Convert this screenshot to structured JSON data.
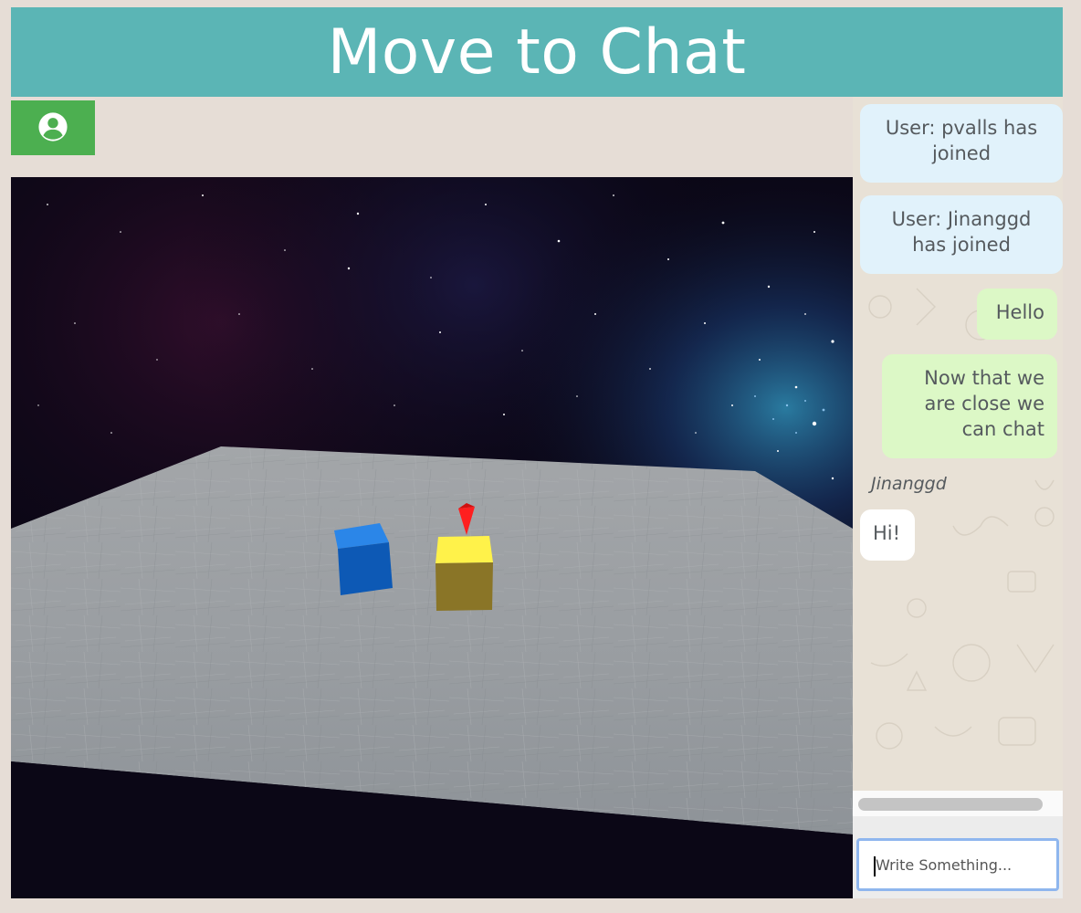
{
  "header": {
    "title": "Move to Chat"
  },
  "toolbar": {
    "profile_icon": "account-circle-icon",
    "profile_color": "#4caf50"
  },
  "scene": {
    "background": "starfield",
    "objects": [
      {
        "name": "blue-cube",
        "color": "#1a6fd6"
      },
      {
        "name": "yellow-cube",
        "color": "#f2e63a"
      },
      {
        "name": "position-marker",
        "color": "#ff1a1a"
      }
    ]
  },
  "chat": {
    "messages": [
      {
        "type": "system",
        "text": "User: pvalls has joined"
      },
      {
        "type": "system",
        "text": "User: Jinanggd has joined"
      },
      {
        "type": "own",
        "text": "Hello"
      },
      {
        "type": "own",
        "text": "Now that we are close we can chat"
      },
      {
        "type": "other",
        "sender": "Jinanggd",
        "text": "Hi!"
      }
    ],
    "input": {
      "placeholder": "Write Something..."
    }
  },
  "colors": {
    "header": "#5bb5b5",
    "system_bubble": "#e1f2fb",
    "own_bubble": "#dcf8c6",
    "other_bubble": "#ffffff"
  }
}
